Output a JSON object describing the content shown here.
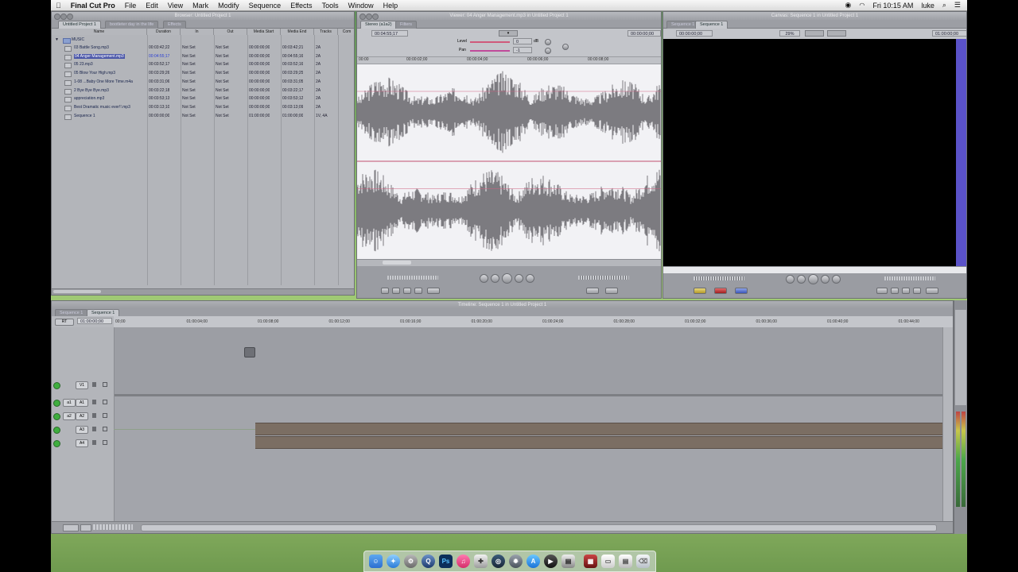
{
  "menubar": {
    "apple": "",
    "app": "Final Cut Pro",
    "items": [
      "File",
      "Edit",
      "View",
      "Mark",
      "Modify",
      "Sequence",
      "Effects",
      "Tools",
      "Window",
      "Help"
    ],
    "clock": "Fri 10:15 AM",
    "user": "luke"
  },
  "browser": {
    "title": "Browser: Untitled Project 1",
    "tabs": [
      "Untitled Project 1",
      "bootleter day in the life",
      "Effects"
    ],
    "columns": [
      "Name",
      "Duration",
      "In",
      "Out",
      "Media Start",
      "Media End",
      "Tracks",
      "Com"
    ],
    "bin": "MUSIC",
    "rows": [
      {
        "name": "03 Battle Song.mp3",
        "duration": "00:03:42;22",
        "in": "Not Set",
        "out": "Not Set",
        "start": "00:00:00;00",
        "end": "00:03:42;21",
        "tracks": "2A"
      },
      {
        "name": "04 Anger Management.mp3",
        "duration": "00:04:55;17",
        "in": "Not Set",
        "out": "Not Set",
        "start": "00:00:00;00",
        "end": "00:04:55;16",
        "tracks": "2A"
      },
      {
        "name": "05 23.mp3",
        "duration": "00:03:52;17",
        "in": "Not Set",
        "out": "Not Set",
        "start": "00:00:00;00",
        "end": "00:03:52;16",
        "tracks": "2A"
      },
      {
        "name": "05 Blow Your High.mp3",
        "duration": "00:03:29;26",
        "in": "Not Set",
        "out": "Not Set",
        "start": "00:00:00;00",
        "end": "00:03:29;25",
        "tracks": "2A"
      },
      {
        "name": "1-08 ...Baby One More Time.m4a",
        "duration": "00:03:31;06",
        "in": "Not Set",
        "out": "Not Set",
        "start": "00:00:00;00",
        "end": "00:03:31;05",
        "tracks": "2A"
      },
      {
        "name": "2 Bye Bye Bye.mp3",
        "duration": "00:03:22;18",
        "in": "Not Set",
        "out": "Not Set",
        "start": "00:00:00;00",
        "end": "00:03:22;17",
        "tracks": "2A"
      },
      {
        "name": "appreciation.mp3",
        "duration": "00:03:53;13",
        "in": "Not Set",
        "out": "Not Set",
        "start": "00:00:00;00",
        "end": "00:03:53;12",
        "tracks": "2A"
      },
      {
        "name": "Best Dramatic music ever!!.mp3",
        "duration": "00:03:13;10",
        "in": "Not Set",
        "out": "Not Set",
        "start": "00:00:00;00",
        "end": "00:03:13;09",
        "tracks": "2A"
      },
      {
        "name": "Sequence 1",
        "duration": "00:00:00;00",
        "in": "Not Set",
        "out": "Not Set",
        "start": "01:00:00;00",
        "end": "01:00:00;00",
        "tracks": "1V, 4A"
      }
    ]
  },
  "viewer": {
    "title": "Viewer: 04 Anger Management.mp3 in Untitled Project 1",
    "tabs": [
      "Stereo (a1a2)",
      "Filters"
    ],
    "timecode": "00:04:55;17",
    "position": "00:00:00;00",
    "level_label": "Level",
    "level_value": "0",
    "level_unit": "dB",
    "pan_label": "Pan",
    "pan_value": "-1",
    "ruler": [
      "00:00",
      "00:00:02;00",
      "00:00:04;00",
      "00:00:06;00",
      "00:00:08;00"
    ]
  },
  "canvas": {
    "title": "Canvas: Sequence 1 in Untitled Project 1",
    "tabs": [
      "Sequence 1",
      "Sequence 1"
    ],
    "timecode_left": "00:00:00;00",
    "timecode_right": "01:00:00;00",
    "zoom": "29%"
  },
  "timeline": {
    "title": "Timeline: Sequence 1 in Untitled Project 1",
    "tabs": [
      "Sequence 1",
      "Sequence 1"
    ],
    "rt": "RT",
    "timecode": "01:00:00;00",
    "ruler": [
      "00;00",
      "01:00:04;00",
      "01:00:08;00",
      "01:00:12;00",
      "01:00:16;00",
      "01:00:20;00",
      "01:00:24;00",
      "01:00:28;00",
      "01:00:32;00",
      "01:00:36;00",
      "01:00:40;00",
      "01:00:44;00"
    ],
    "tracks": [
      {
        "src": "",
        "dst": "V1"
      },
      {
        "src": "a1",
        "dst": "A1"
      },
      {
        "src": "a2",
        "dst": "A2"
      },
      {
        "src": "",
        "dst": "A3"
      },
      {
        "src": "",
        "dst": "A4"
      }
    ]
  }
}
